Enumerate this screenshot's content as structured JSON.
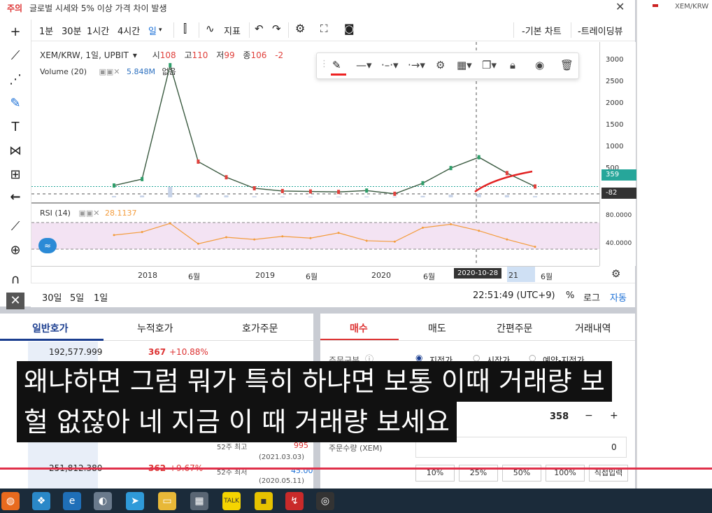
{
  "notice": {
    "tag": "주의",
    "message": "글로벌 시세와 5% 이상 가격 차이 발생",
    "close": "✕"
  },
  "right_mini": {
    "label": "XEM/KRW"
  },
  "toolbar": {
    "intervals": [
      "1분",
      "30분",
      "1시간",
      "4시간",
      "일"
    ],
    "active_interval": "일",
    "indicator_label": "지표",
    "basic_chart": "-기본 차트",
    "trading_view": "-트레이딩뷰"
  },
  "legend": {
    "symbol": "XEM/KRW, 1일, UPBIT",
    "open_label": "시",
    "open": "108",
    "high_label": "고",
    "high": "110",
    "low_label": "저",
    "low": "99",
    "close_label": "종",
    "close": "106",
    "change": "-2",
    "volume_label": "Volume (20)",
    "volume_value": "5.848M",
    "volume_extra": "없음",
    "rsi_label": "RSI (14)",
    "rsi_value": "28.1137"
  },
  "price_axis": [
    "3000",
    "2500",
    "2000",
    "1500",
    "1000",
    "500"
  ],
  "price_badge": "359",
  "cross_badge": "-82",
  "rsi_axis": [
    "80.0000",
    "40.0000"
  ],
  "time_axis": [
    "2018",
    "6월",
    "2019",
    "6월",
    "2020",
    "6월",
    "21",
    "6월"
  ],
  "cursor_date": "2020-10-28",
  "range_buttons": [
    "30일",
    "5일",
    "1일"
  ],
  "clock": "22:51:49 (UTC+9)",
  "scale_buttons": {
    "pct": "%",
    "log": "로그",
    "auto": "자동"
  },
  "orderbook": {
    "tabs": [
      "일반호가",
      "누적호가",
      "호가주문"
    ],
    "active_tab": "일반호가",
    "rows": [
      {
        "volume": "192,577.999",
        "price": "367",
        "change": "+10.88%"
      },
      {
        "volume": "251,812.380",
        "price": "362",
        "change": "+9.67%"
      }
    ],
    "info": [
      {
        "label": "52주 최고",
        "value": "995",
        "date": "(2021.03.03)"
      },
      {
        "label": "52주 최저",
        "value": "45.00",
        "date": "(2020.05.11)"
      }
    ]
  },
  "trade": {
    "tabs": [
      "매수",
      "매도",
      "간편주문",
      "거래내역"
    ],
    "active_tab": "매수",
    "order_type_label": "주문구분",
    "order_types": [
      "지정가",
      "시장가",
      "예약-지정가"
    ],
    "price_value": "358",
    "qty_label": "주문수량 (XEM)",
    "qty_value": "0",
    "percent_buttons": [
      "10%",
      "25%",
      "50%",
      "100%"
    ],
    "direct_input": "직접입력"
  },
  "subtitle": {
    "line1": "왜냐하면 그럼 뭐가 특히 하냐면 보통 이때 거래량 보",
    "line2": "헐 없잖아 네 지금 이 때 거래량 보세요"
  },
  "chart_data": {
    "type": "line",
    "title": "XEM/KRW, 1일, UPBIT",
    "ylim": [
      0,
      3200
    ],
    "x": [
      "2017-11",
      "2017-12",
      "2018-01",
      "2018-02",
      "2018-04",
      "2018-07",
      "2019-01",
      "2019-07",
      "2020-01",
      "2020-07",
      "2020-10",
      "2021-01",
      "2021-02",
      "2021-03",
      "2021-04",
      "2021-05"
    ],
    "series": [
      {
        "values": [
          380,
          520,
          3000,
          900,
          560,
          320,
          260,
          250,
          240,
          270,
          200,
          430,
          760,
          995,
          650,
          359
        ]
      }
    ],
    "rsi_series": {
      "name": "RSI (14)",
      "values": [
        55,
        62,
        82,
        35,
        50,
        45,
        52,
        48,
        60,
        42,
        40,
        72,
        80,
        65,
        45,
        28
      ]
    },
    "colors": {
      "up": "#2e9e6a",
      "down": "#e0413c",
      "rsi": "#f39c3c",
      "trend": "#e22222"
    }
  }
}
